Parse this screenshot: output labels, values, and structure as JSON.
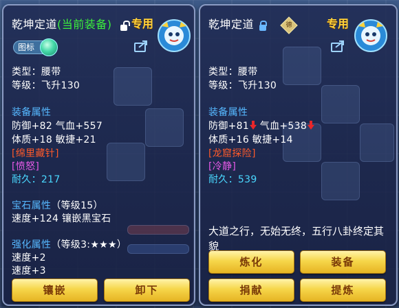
{
  "left_panel": {
    "item_name": "乾坤定道",
    "equipped_tag": "(当前装备)",
    "exclusive": "专用",
    "icon_tag": "图标",
    "type": "类型：腰带",
    "level": "等级：飞升130",
    "equip_attrs_header": "装备属性",
    "attr_line1": "防御+82 气血+557",
    "attr_line2": "体质+18 敏捷+21",
    "special_skill": "[绵里藏针]",
    "special_effect": "[愤怒]",
    "durability_label": "耐久：",
    "durability_value": "217",
    "gem_header": "宝石属性",
    "gem_level": "（等级15）",
    "gem_line": "速度+124 镶嵌黑宝石",
    "enhance_header": "强化属性",
    "enhance_level": "（等级3:★★★）",
    "enhance_line1": "速度+2",
    "enhance_line2": "速度+3",
    "buttons": {
      "inlay": "镶嵌",
      "unequip": "卸下"
    }
  },
  "right_panel": {
    "item_name": "乾坤定道",
    "exclusive": "专用",
    "seal_glyph": "德",
    "type": "类型：腰带",
    "level": "等级：飞升130",
    "equip_attrs_header": "装备属性",
    "attr_def": "防御+81",
    "attr_hp": " 气血+538",
    "attr_line2": "体质+16 敏捷+14",
    "special_skill": "[龙窟探险]",
    "special_effect": "[冷静]",
    "durability_label": "耐久：",
    "durability_value": "539",
    "flavor_text": "大道之行，无始无终，五行八卦终定其貌",
    "buttons": {
      "refine": "炼化",
      "equip": "装备",
      "donate": "捐献",
      "extract": "提炼"
    }
  },
  "colors": {
    "section_header": "#56b8ff",
    "special_skill": "#ff5a2a",
    "special_effect": "#e85ae8",
    "durability": "#4ad8ff",
    "equipped_tag": "#3cf03c",
    "exclusive": "#ffd23a",
    "button_gold": "#f6d64a"
  }
}
